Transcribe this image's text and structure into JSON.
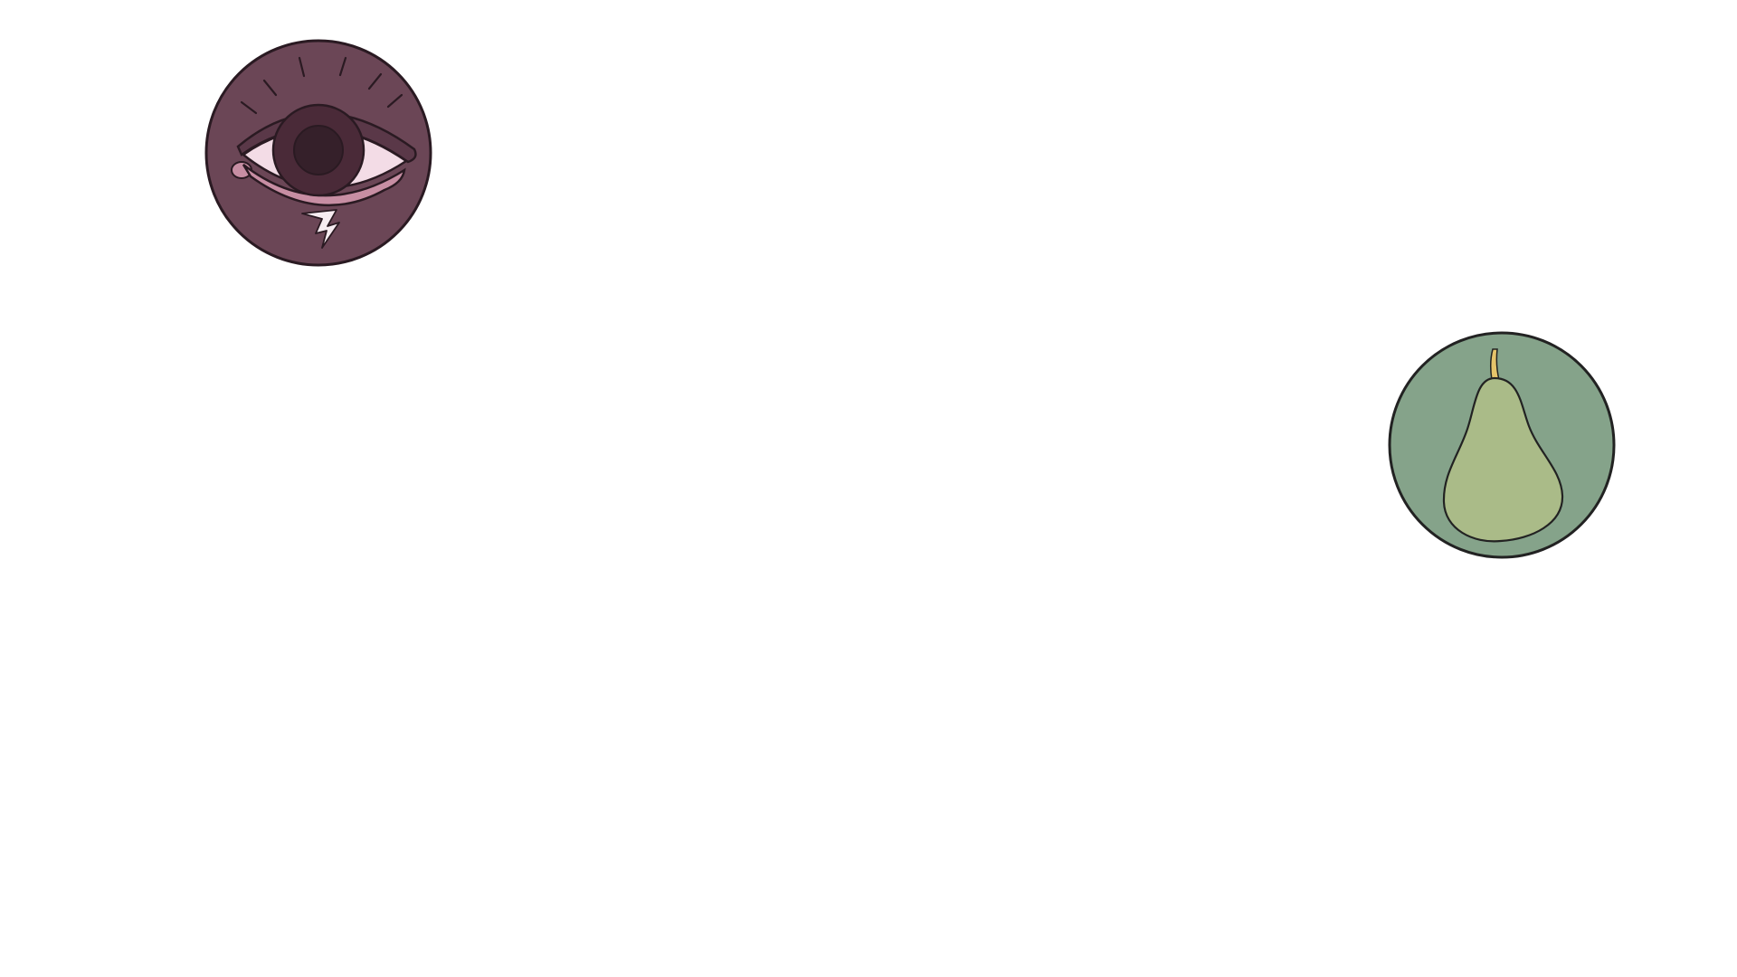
{
  "tokens": [
    {
      "id": "eye",
      "icon": "eye-with-lightning-icon",
      "colors": {
        "disc": "#6b4656",
        "lid": "#5a3848",
        "sclera": "#f3dce6",
        "iris": "#4a2a38",
        "pupil": "#35202a",
        "accent": "#c78ea3",
        "outline": "#2a1a22"
      }
    },
    {
      "id": "pear",
      "icon": "pear-icon",
      "colors": {
        "disc": "#85a38a",
        "fruit": "#aabb88",
        "stem": "#e6c46a",
        "outline": "#222222"
      }
    }
  ]
}
